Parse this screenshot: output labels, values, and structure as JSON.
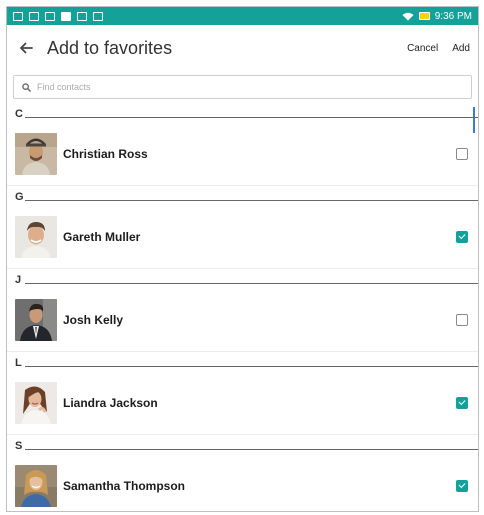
{
  "status_bar": {
    "time": "9:36 PM",
    "colors": {
      "bar": "#14a19a",
      "battery": "#f5d400"
    },
    "left_icons": [
      "notification-icon",
      "image-icon",
      "mail-icon",
      "cloud-icon",
      "calendar-icon",
      "photo-icon"
    ]
  },
  "toolbar": {
    "title": "Add to favorites",
    "cancel_label": "Cancel",
    "add_label": "Add"
  },
  "search": {
    "placeholder": "Find contacts",
    "value": ""
  },
  "accent_color": "#14a19a",
  "sections": [
    {
      "letter": "C",
      "contacts": [
        {
          "name": "Christian Ross",
          "checked": false
        }
      ]
    },
    {
      "letter": "G",
      "contacts": [
        {
          "name": "Gareth Muller",
          "checked": true
        }
      ]
    },
    {
      "letter": "J",
      "contacts": [
        {
          "name": "Josh Kelly",
          "checked": false
        }
      ]
    },
    {
      "letter": "L",
      "contacts": [
        {
          "name": "Liandra Jackson",
          "checked": true
        }
      ]
    },
    {
      "letter": "S",
      "contacts": [
        {
          "name": "Samantha Thompson",
          "checked": true
        }
      ]
    }
  ]
}
